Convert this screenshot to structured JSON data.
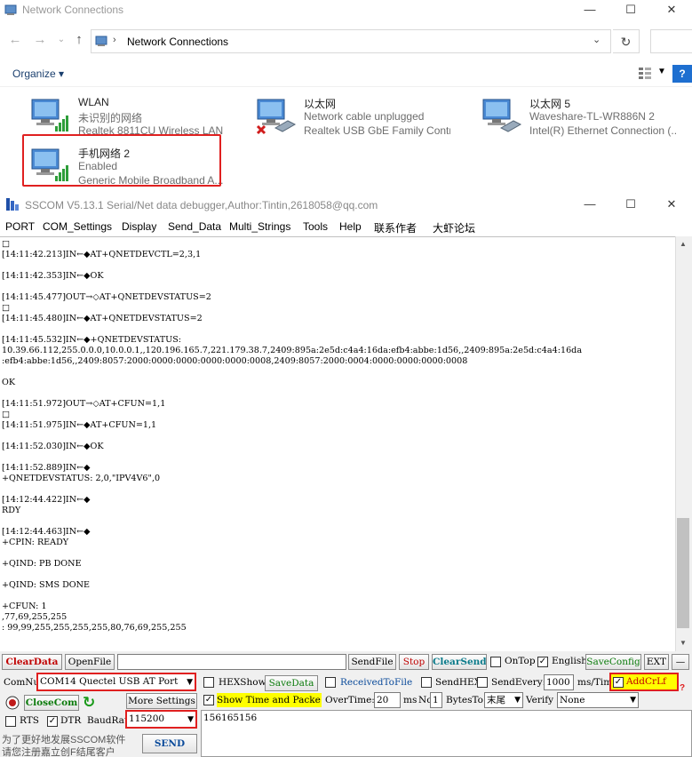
{
  "network_connections": {
    "title": "Network Connections",
    "window_controls": [
      "—",
      "☐",
      "✕"
    ],
    "breadcrumb": "Network Connections",
    "organize_label": "Organize ▾",
    "connections": [
      {
        "name": "WLAN",
        "status": "未识别的网络",
        "device": "Realtek 8811CU Wireless LAN ..."
      },
      {
        "name": "以太网",
        "status": "Network cable unplugged",
        "device": "Realtek USB GbE Family Contr..."
      },
      {
        "name": "以太网 5",
        "status": "Waveshare-TL-WR886N 2",
        "device": "Intel(R) Ethernet Connection (..."
      },
      {
        "name": "手机网络 2",
        "status": "Enabled",
        "device": "Generic Mobile Broadband A..."
      }
    ],
    "help_label": "?"
  },
  "sscom": {
    "title": "SSCOM V5.13.1 Serial/Net data debugger,Author:Tintin,2618058@qq.com",
    "window_controls": [
      "—",
      "☐",
      "✕"
    ],
    "menu": [
      "PORT",
      "COM_Settings",
      "Display",
      "Send_Data",
      "Multi_Strings",
      "Tools",
      "Help",
      "联系作者",
      "大虾论坛"
    ],
    "output_lines": [
      "□",
      "[14:11:42.213]IN←◆AT+QNETDEVCTL=2,3,1",
      "",
      "[14:11:42.353]IN←◆OK",
      "",
      "[14:11:45.477]OUT→◇AT+QNETDEVSTATUS=2",
      "□",
      "[14:11:45.480]IN←◆AT+QNETDEVSTATUS=2",
      "",
      "[14:11:45.532]IN←◆+QNETDEVSTATUS:",
      "10.39.66.112,255.0.0.0,10.0.0.1,,120.196.165.7,221.179.38.7,2409:895a:2e5d:c4a4:16da:efb4:abbe:1d56,,2409:895a:2e5d:c4a4:16da",
      ":efb4:abbe:1d56,,2409:8057:2000:0000:0000:0000:0000:0008,2409:8057:2000:0004:0000:0000:0000:0008",
      "",
      "OK",
      "",
      "[14:11:51.972]OUT→◇AT+CFUN=1,1",
      "□",
      "[14:11:51.975]IN←◆AT+CFUN=1,1",
      "",
      "[14:11:52.030]IN←◆OK",
      "",
      "[14:11:52.889]IN←◆",
      "+QNETDEVSTATUS: 2,0,\"IPV4V6\",0",
      "",
      "[14:12:44.422]IN←◆",
      "RDY",
      "",
      "[14:12:44.463]IN←◆",
      "+CPIN: READY",
      "",
      "+QIND: PB DONE",
      "",
      "+QIND: SMS DONE",
      "",
      "+CFUN: 1",
      ",77,69,255,255",
      ": 99,99,255,255,255,255,80,76,69,255,255"
    ],
    "row1": {
      "clear_data": "ClearData",
      "open_file": "OpenFile",
      "file_path": "",
      "send_file": "SendFile",
      "stop": "Stop",
      "clear_send": "ClearSend",
      "on_top": "OnTop",
      "english": "English",
      "save_config": "SaveConfig",
      "ext": "EXT",
      "minus": "—"
    },
    "row2": {
      "comnum_label": "ComNum",
      "com_port": "COM14 Quectel USB AT Port",
      "hex_show": "HEXShow",
      "save_data": "SaveData",
      "received_to_file": "ReceivedToFile",
      "send_hex": "SendHEX",
      "send_every": "SendEvery:",
      "interval": "1000",
      "interval_unit": "ms/Tim",
      "add_crlf": "AddCrLf"
    },
    "row3": {
      "close_com": "CloseCom",
      "more_settings": "More Settings",
      "show_time": "Show Time and Packe",
      "overtime_label": "OverTime:",
      "overtime_value": "20",
      "overtime_unit": "ms",
      "no_label": "No",
      "no_value": "1",
      "bytes_to_label": "BytesTo",
      "bytes_to_value": "末尾",
      "verify_label": "Verify",
      "verify_value": "None"
    },
    "row4": {
      "rts": "RTS",
      "dtr": "DTR",
      "baud_label": "BaudRat",
      "baud_value": "115200",
      "send_text": "156165156"
    },
    "ad_text_1": "为了更好地发展SSCOM软件",
    "ad_text_2": "请您注册嘉立创F结尾客户",
    "send_button": "SEND"
  },
  "colors": {
    "highlight_red": "#e02020",
    "addcrlf_yellow": "#ffff00",
    "save_green": "#0a7a0a",
    "clear_red": "#c00000"
  }
}
